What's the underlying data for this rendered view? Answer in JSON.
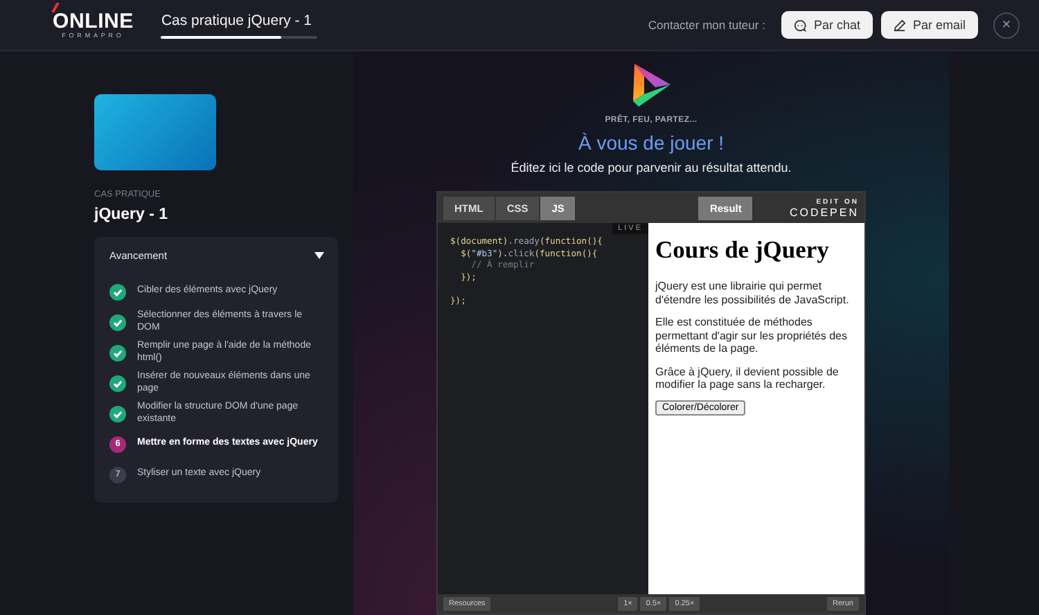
{
  "header": {
    "logo": {
      "name": "ONLINE",
      "tagline": "FORMAPRO"
    },
    "title": "Cas pratique jQuery - 1",
    "progress": {
      "level": 0.77
    },
    "contact_label": "Contacter mon tuteur :",
    "buttons": [
      {
        "label": "Par chat",
        "kind": "chat"
      },
      {
        "label": "Par email",
        "kind": "email"
      }
    ],
    "close": "×"
  },
  "sidebar": {
    "kicker": "CAS PRATIQUE",
    "title": "jQuery - 1",
    "panel": {
      "title": "Avancement",
      "expanded": true,
      "steps": [
        {
          "label": "Cibler des éléments avec jQuery",
          "completed": true,
          "current": false
        },
        {
          "label": "Sélectionner des éléments à travers le DOM",
          "completed": true,
          "current": false
        },
        {
          "label": "Remplir une page à l'aide de la méthode html()",
          "completed": true,
          "current": false
        },
        {
          "label": "Insérer de nouveaux éléments dans une page",
          "completed": true,
          "current": false
        },
        {
          "label": "Modifier la structure DOM d'une page existante",
          "completed": true,
          "current": false
        },
        {
          "label": "Mettre en forme des textes avec jQuery",
          "completed": false,
          "current": true,
          "number": "6"
        },
        {
          "label": "Styliser un texte avec jQuery",
          "completed": false,
          "current": false,
          "number": "7"
        }
      ]
    }
  },
  "main": {
    "eyebrow": "PRÊT, FEU, PARTEZ...",
    "heading": "À vous de jouer !",
    "instructions": "Éditez ici le code pour parvenir au résultat attendu.",
    "embed": {
      "tabs": [
        {
          "label": "HTML",
          "selected": false
        },
        {
          "label": "CSS",
          "selected": false
        },
        {
          "label": "JS",
          "selected": true
        }
      ],
      "result_tab": {
        "label": "Result",
        "selected": true
      },
      "brand": {
        "top": "EDIT ON",
        "name": "CODEPEN"
      },
      "live_badge": "LIVE",
      "code_blocks": [
        [
          [
            {
              "text": "$(document)",
              "kind": "fn"
            },
            {
              "text": ".ready",
              "kind": "method"
            },
            {
              "text": "(function(){",
              "kind": "fn"
            }
          ],
          [
            {
              "text": "  $(",
              "kind": "fn"
            },
            {
              "text": "\"#b3\"",
              "kind": "string"
            },
            {
              "text": ").",
              "kind": "fn"
            },
            {
              "text": "click",
              "kind": "method"
            },
            {
              "text": "(function(){",
              "kind": "fn"
            }
          ],
          [
            {
              "text": "    // À remplir",
              "kind": "comment"
            }
          ],
          [
            {
              "text": "  });",
              "kind": "fn"
            }
          ]
        ],
        [
          [
            {
              "text": "});",
              "kind": "fn"
            }
          ]
        ]
      ],
      "result": {
        "heading": "Cours de jQuery",
        "paragraphs": [
          "jQuery est une librairie qui permet d'étendre les possibilités de JavaScript.",
          "Elle est constituée de méthodes permettant d'agir sur les propriétés des éléments de la page.",
          "Grâce à jQuery, il devient possible de modifier la page sans la recharger."
        ],
        "button": "Colorer/Décolorer"
      },
      "footer": {
        "resources": "Resources",
        "zoom": [
          "1×",
          "0.5×",
          "0.25×"
        ],
        "rerun": "Rerun"
      }
    }
  }
}
